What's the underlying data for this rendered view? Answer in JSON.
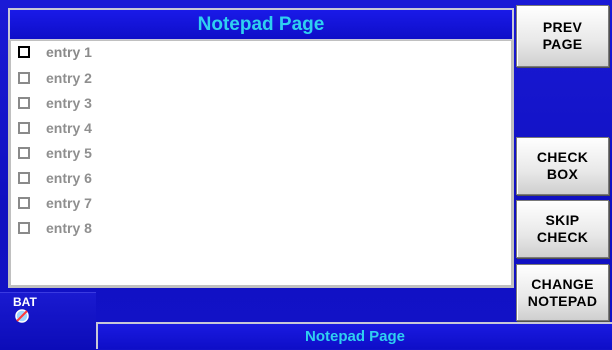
{
  "header": {
    "title": "Notepad Page"
  },
  "entries": [
    {
      "label": "entry 1",
      "checked": false,
      "active": true
    },
    {
      "label": "entry 2",
      "checked": false,
      "active": false
    },
    {
      "label": "entry 3",
      "checked": false,
      "active": false
    },
    {
      "label": "entry 4",
      "checked": false,
      "active": false
    },
    {
      "label": "entry 5",
      "checked": false,
      "active": false
    },
    {
      "label": "entry 6",
      "checked": false,
      "active": false
    },
    {
      "label": "entry 7",
      "checked": false,
      "active": false
    },
    {
      "label": "entry 8",
      "checked": false,
      "active": false
    }
  ],
  "buttons": {
    "prev_page": "PREV\nPAGE",
    "check_box": "CHECK\nBOX",
    "skip_check": "SKIP\nCHECK",
    "change_notepad": "CHANGE\nNOTEPAD"
  },
  "status": {
    "battery_label": "BAT",
    "battery_icon": "battery-status-icon",
    "footer_title": "Notepad Page"
  },
  "colors": {
    "background": "#1212c8",
    "title_text": "#2fd0f0",
    "entry_text": "#8f8f8f"
  }
}
